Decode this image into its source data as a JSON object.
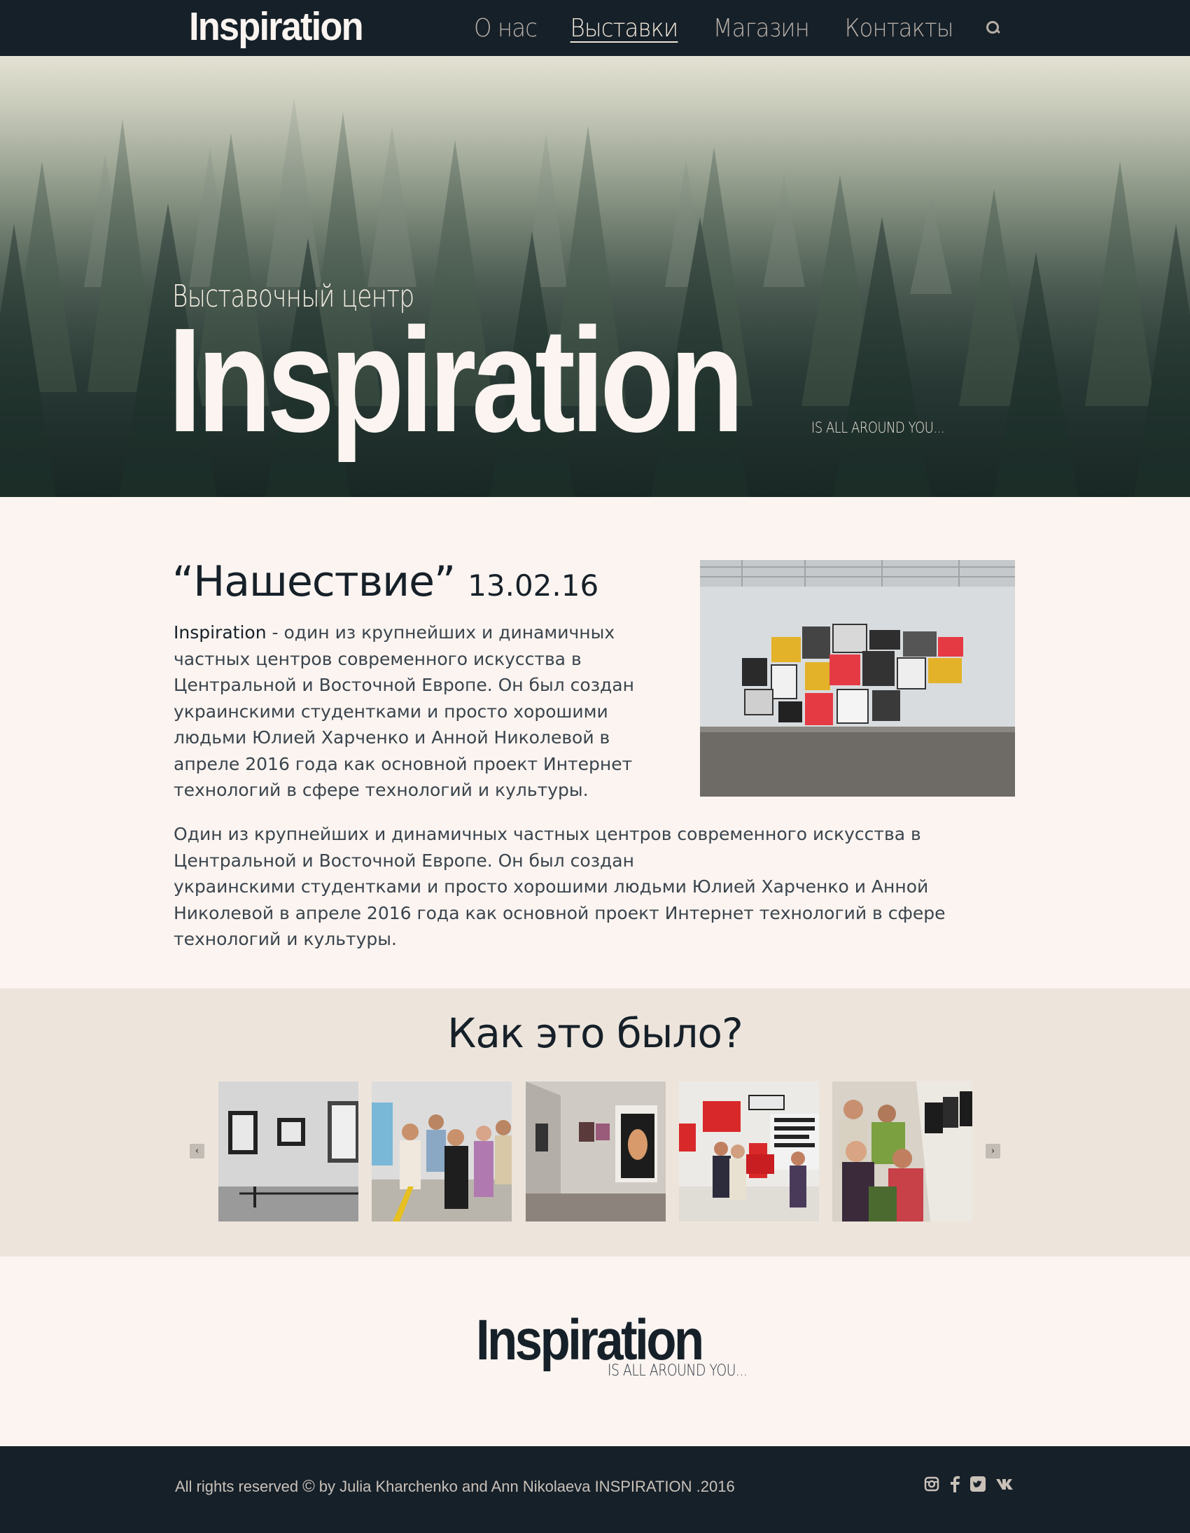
{
  "nav": {
    "logo": "Inspiration",
    "items": [
      "О нас",
      "Выставки",
      "Магазин",
      "Контакты"
    ],
    "active_index": 1,
    "search_icon": "search-icon"
  },
  "hero": {
    "subtitle": "Выставочный центр",
    "title": "Inspiration",
    "tagline": "IS ALL AROUND YOU..."
  },
  "article": {
    "title": "“Нашествие”",
    "date": "13.02.16",
    "intro_bold": "Inspiration",
    "intro_text": " - один из крупнейших и динамичных частных центров современного искусства в Центральной и Восточной Европе. Он был создан украинскими студентками и просто хорошими людьми Юлией Харченко и Анной Николевой в апреле 2016 года как основной проект Интернет технологий в сфере технологий и культуры.",
    "body_line1": "Один из крупнейших и динамичных частных центров современного искусства в Центральной и Восточной Европе. Он был создан",
    "body_line2": "украинскими студентками и просто хорошими людьми Юлией Харченко и Анной Николевой в апреле 2016 года как основной проект Интернет технологий в сфере технологий и культуры."
  },
  "gallery": {
    "title": "Как это было?",
    "prev_icon": "chevron-left-icon",
    "next_icon": "chevron-right-icon",
    "prev_glyph": "‹",
    "next_glyph": "›"
  },
  "footer_logo": {
    "title": "Inspiration",
    "tagline": "IS ALL AROUND YOU..."
  },
  "footer": {
    "rights": "All rights reserved",
    "copy_symbol": "©",
    "credits": "by Julia Kharchenko and Ann Nikolaeva  INSPIRATION .2016",
    "social_icons": [
      "instagram-icon",
      "facebook-icon",
      "twitter-icon",
      "vk-icon"
    ]
  },
  "colors": {
    "nav_bg": "#162029",
    "page_bg": "#fbf4f0",
    "gallery_bg": "#ede5dc",
    "text_dark": "#162029"
  }
}
